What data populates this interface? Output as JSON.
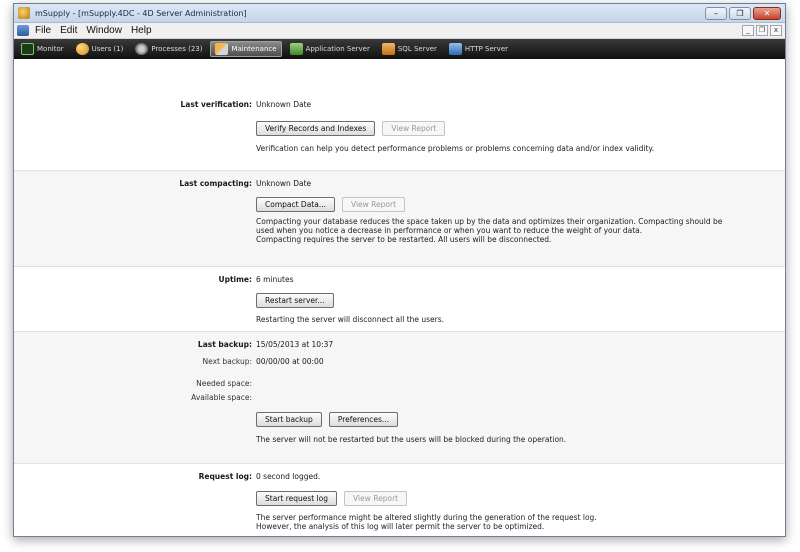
{
  "window": {
    "title": "mSupply - [mSupply.4DC - 4D Server Administration]",
    "controls": {
      "minimize": "–",
      "maximize": "❐",
      "close": "✕"
    }
  },
  "menubar": {
    "items": [
      "File",
      "Edit",
      "Window",
      "Help"
    ],
    "mdi": {
      "minimize": "_",
      "restore": "❐",
      "close": "x"
    }
  },
  "tabs": [
    {
      "label": "Monitor",
      "icon": "monitor-icon"
    },
    {
      "label": "Users (1)",
      "icon": "users-icon"
    },
    {
      "label": "Processes (23)",
      "icon": "processes-icon"
    },
    {
      "label": "Maintenance",
      "icon": "maintenance-icon",
      "active": true
    },
    {
      "label": "Application Server",
      "icon": "application-server-icon"
    },
    {
      "label": "SQL Server",
      "icon": "sql-server-icon"
    },
    {
      "label": "HTTP Server",
      "icon": "http-server-icon"
    }
  ],
  "verification": {
    "label": "Last verification:",
    "value": "Unknown Date",
    "verify_button": "Verify Records and Indexes",
    "report_button": "View Report",
    "desc": "Verification can help you detect performance problems or problems concerning data and/or index validity."
  },
  "compacting": {
    "label": "Last compacting:",
    "value": "Unknown Date",
    "compact_button": "Compact Data...",
    "report_button": "View Report",
    "desc_lines": [
      "Compacting your database reduces the space taken up by the data and optimizes their organization. Compacting should be",
      "used when you notice a decrease in performance or when you want to reduce the weight of your data.",
      "Compacting requires the server to be restarted. All users will be disconnected."
    ]
  },
  "uptime": {
    "label": "Uptime:",
    "value": "6 minutes",
    "restart_button": "Restart server...",
    "desc": "Restarting the server will disconnect all the users."
  },
  "backup": {
    "last_label": "Last backup:",
    "last_value": "15/05/2013 at 10:37",
    "next_label": "Next backup:",
    "next_value": "00/00/00 at 00:00",
    "needed_label": "Needed space:",
    "available_label": "Available space:",
    "start_button": "Start backup",
    "prefs_button": "Preferences...",
    "desc": "The server will not be restarted but the users will be blocked during the operation."
  },
  "request_log": {
    "label": "Request log:",
    "value": "0 second logged.",
    "start_button": "Start request log",
    "report_button": "View Report",
    "desc_lines": [
      "The server performance might be altered slightly during the generation of the request log.",
      "However, the analysis of this log will later permit the server to be optimized."
    ]
  }
}
